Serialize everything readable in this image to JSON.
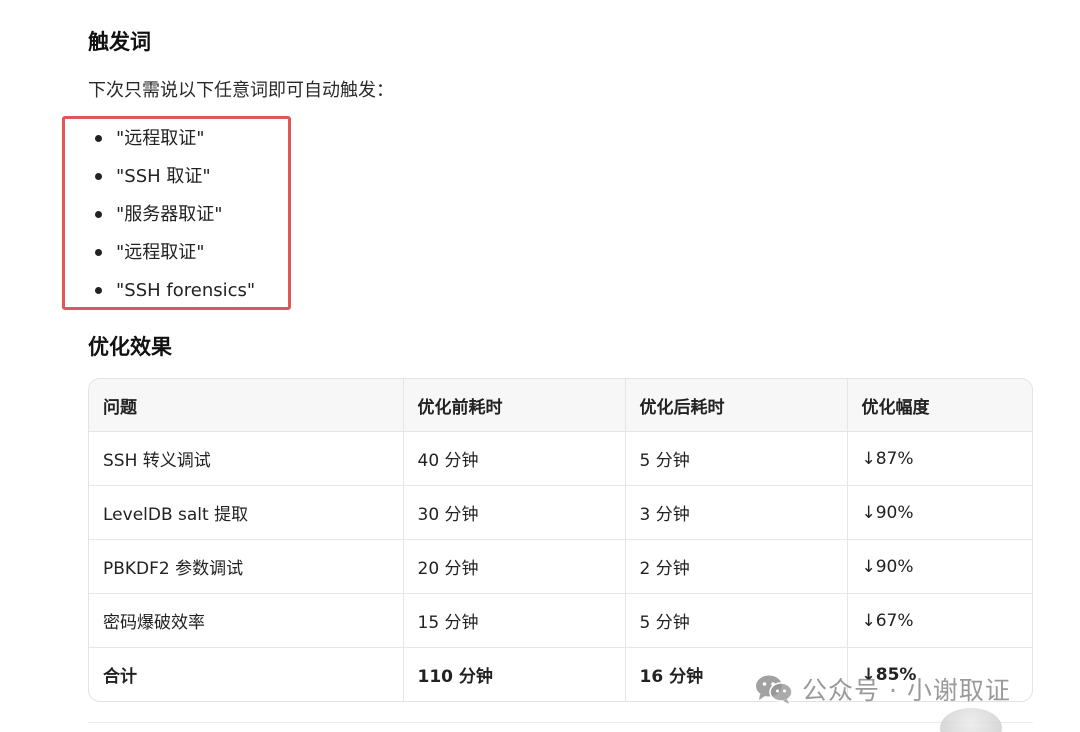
{
  "sections": {
    "triggers": {
      "title": "触发词",
      "intro": "下次只需说以下任意词即可自动触发：",
      "items": [
        "\"远程取证\"",
        "\"SSH 取证\"",
        "\"服务器取证\"",
        "\"远程取证\"",
        "\"SSH forensics\""
      ]
    },
    "results": {
      "title": "优化效果",
      "table": {
        "headers": [
          "问题",
          "优化前耗时",
          "优化后耗时",
          "优化幅度"
        ],
        "rows": [
          [
            "SSH 转义调试",
            "40 分钟",
            "5 分钟",
            "↓87%"
          ],
          [
            "LevelDB salt 提取",
            "30 分钟",
            "3 分钟",
            "↓90%"
          ],
          [
            "PBKDF2 参数调试",
            "20 分钟",
            "2 分钟",
            "↓90%"
          ],
          [
            "密码爆破效率",
            "15 分钟",
            "5 分钟",
            "↓67%"
          ],
          [
            "合计",
            "110 分钟",
            "16 分钟",
            "↓85%"
          ]
        ]
      }
    }
  },
  "watermark": {
    "text": "公众号 · 小谢取证",
    "icon": "wechat-icon"
  },
  "colors": {
    "highlight_border": "#e25656",
    "header_bg": "#f7f7f7"
  }
}
